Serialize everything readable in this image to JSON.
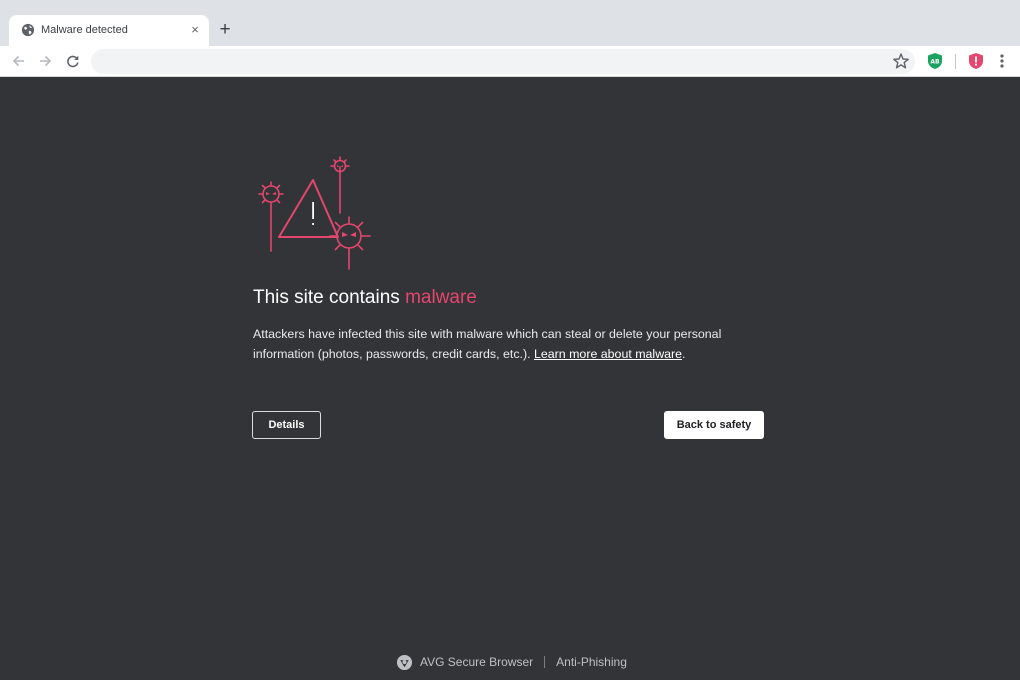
{
  "browser": {
    "tab": {
      "title": "Malware detected",
      "close_glyph": "×",
      "icon": "globe-icon"
    },
    "new_tab_glyph": "+",
    "address_bar": {
      "value": "",
      "placeholder": ""
    },
    "extensions": [
      {
        "name": "adblock-extension-icon",
        "label": "AB",
        "color": "#1aa260"
      },
      {
        "name": "shield-extension-icon",
        "label": "!",
        "color": "#e3466e"
      }
    ]
  },
  "page": {
    "heading_prefix": "This site contains ",
    "heading_accent": "malware",
    "description_text": "Attackers have infected this site with malware which can steal or delete your personal information (photos, passwords, credit cards, etc.). ",
    "learn_more_link": "Learn more about malware",
    "description_end": ".",
    "details_button": "Details",
    "back_button": "Back to safety"
  },
  "footer": {
    "brand": "AVG Secure Browser",
    "feature": "Anti-Phishing"
  },
  "colors": {
    "accent": "#e3466e",
    "background": "#323437",
    "tabstrip": "#dee1e6"
  }
}
